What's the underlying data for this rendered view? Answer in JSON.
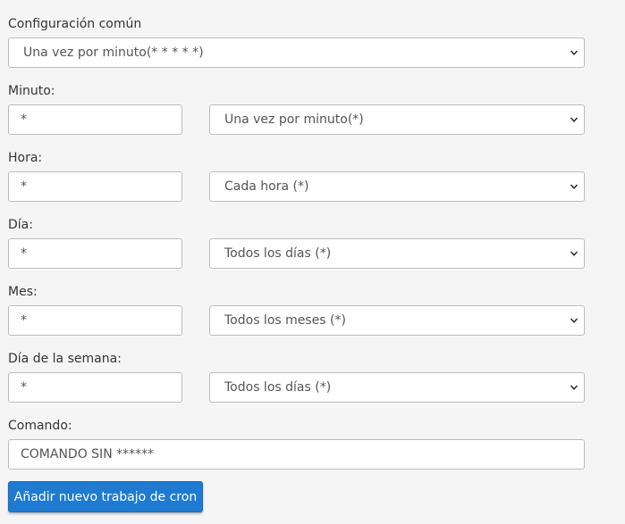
{
  "common": {
    "label": "Configuración común",
    "selected": "Una vez por minuto(* * * * *)"
  },
  "fields": {
    "minute": {
      "label": "Minuto:",
      "value": "*",
      "selected": "Una vez por minuto(*)"
    },
    "hour": {
      "label": "Hora:",
      "value": "*",
      "selected": "Cada hora (*)"
    },
    "day": {
      "label": "Día:",
      "value": "*",
      "selected": "Todos los días (*)"
    },
    "month": {
      "label": "Mes:",
      "value": "*",
      "selected": "Todos los meses (*)"
    },
    "weekday": {
      "label": "Día de la semana:",
      "value": "*",
      "selected": "Todos los días (*)"
    }
  },
  "command": {
    "label": "Comando:",
    "value": "COMANDO SIN ******"
  },
  "submit": {
    "label": "Añadir nuevo trabajo de cron"
  },
  "icons": {
    "dropdown": "chevron-down-icon"
  },
  "colors": {
    "background": "#f5f5f5",
    "button": "#1f7bd1",
    "border": "#bcbcbc"
  }
}
